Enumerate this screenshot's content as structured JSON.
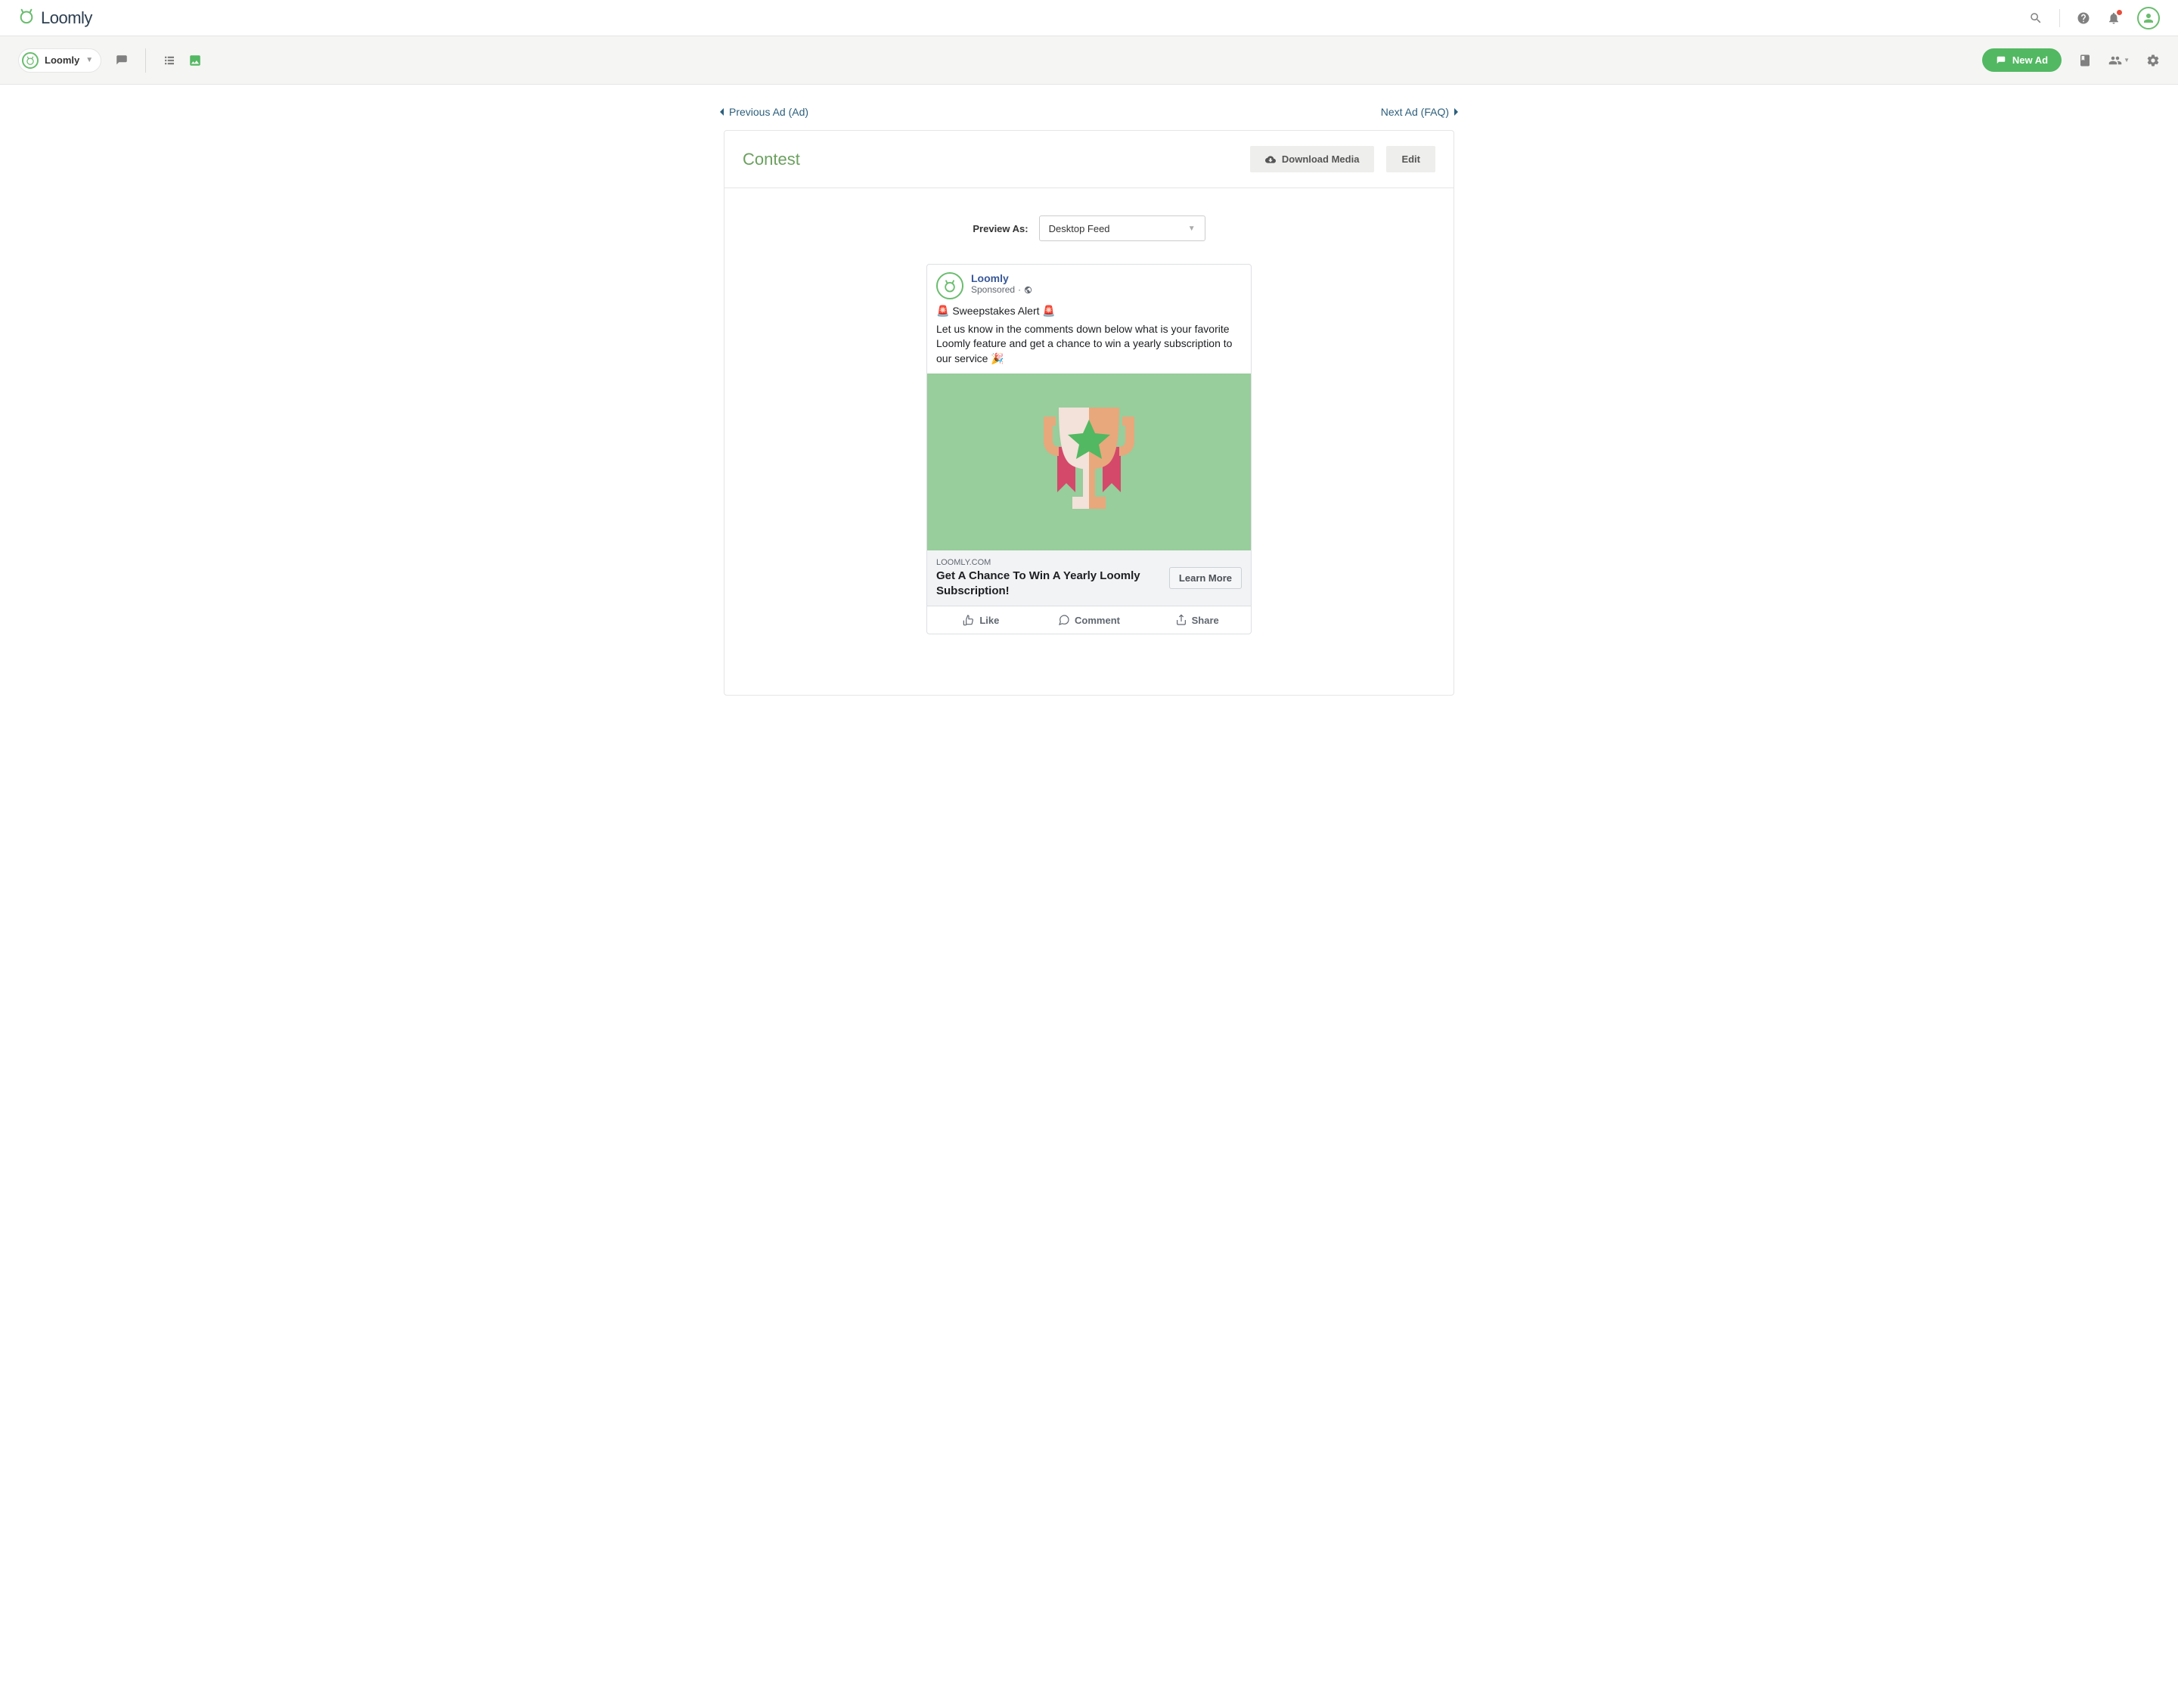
{
  "header": {
    "brand": "Loomly"
  },
  "subheader": {
    "calendar_name": "Loomly",
    "new_ad": "New Ad"
  },
  "nav": {
    "prev": "Previous Ad (Ad)",
    "next": "Next Ad (FAQ)"
  },
  "card": {
    "title": "Contest",
    "download": "Download Media",
    "edit": "Edit"
  },
  "preview": {
    "label": "Preview As:",
    "selected": "Desktop Feed"
  },
  "fb": {
    "page_name": "Loomly",
    "sponsored": "Sponsored",
    "body_line1": "🚨 Sweepstakes Alert 🚨",
    "body_line2": "Let us know in the comments down below what is your favorite Loomly feature and get a chance to win a yearly subscription to our service 🎉",
    "link_domain": "LOOMLY.COM",
    "link_title": "Get A Chance To Win A Yearly Loomly Subscription!",
    "cta": "Learn More",
    "like": "Like",
    "comment": "Comment",
    "share": "Share"
  }
}
